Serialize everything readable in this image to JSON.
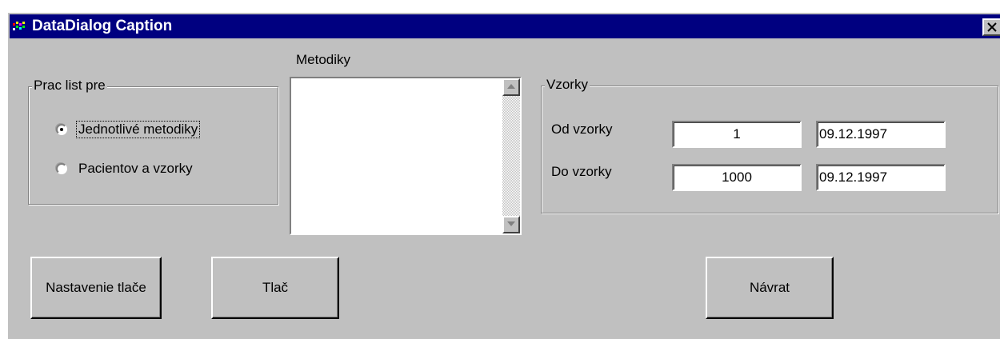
{
  "window": {
    "title": "DataDialog Caption"
  },
  "methods_list": {
    "label": "Metodiky",
    "items": []
  },
  "worksheet_group": {
    "title": "Prac list pre",
    "options": [
      {
        "label": "Jednotlivé metodiky",
        "selected": true
      },
      {
        "label": "Pacientov a vzorky",
        "selected": false
      }
    ]
  },
  "samples_group": {
    "title": "Vzorky",
    "from": {
      "label": "Od vzorky",
      "number": "1",
      "date": "09.12.1997"
    },
    "to": {
      "label": "Do vzorky",
      "number": "1000",
      "date": "09.12.1997"
    }
  },
  "buttons": {
    "print_setup": "Nastavenie tlače",
    "print": "Tlač",
    "back": "Návrat"
  },
  "icons": {
    "app": "app-icon",
    "close": "close-icon",
    "scroll_up": "scroll-up-arrow-icon",
    "scroll_down": "scroll-down-arrow-icon"
  },
  "colors": {
    "titlebar": "#000080",
    "face": "#c0c0c0"
  }
}
